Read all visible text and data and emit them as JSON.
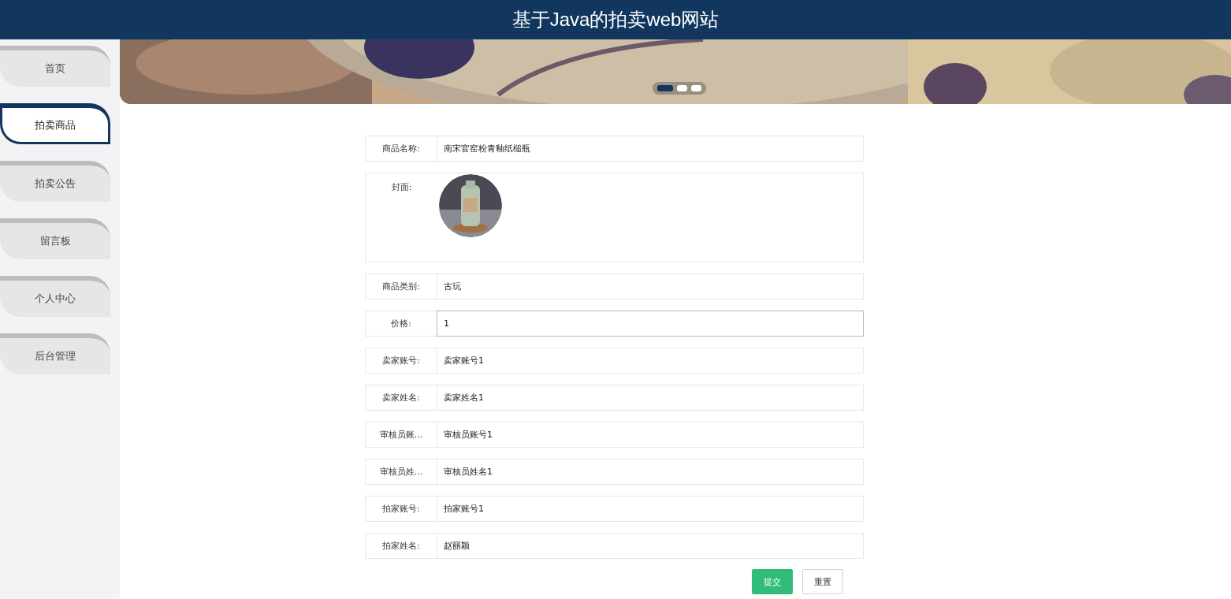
{
  "header": {
    "title": "基于Java的拍卖web网站"
  },
  "nav": [
    {
      "label": "首页",
      "selected": false
    },
    {
      "label": "拍卖商品",
      "selected": true
    },
    {
      "label": "拍卖公告",
      "selected": false
    },
    {
      "label": "留言板",
      "selected": false
    },
    {
      "label": "个人中心",
      "selected": false
    },
    {
      "label": "后台管理",
      "selected": false
    }
  ],
  "banner": {
    "kind": "picture",
    "dots": [
      {
        "selected": true
      },
      {
        "selected": false
      },
      {
        "selected": false
      }
    ]
  },
  "form": {
    "fields": [
      {
        "kind": "text",
        "label": "商品名称:",
        "value": "南宋官窑粉青釉纸槌瓶",
        "focused": false
      },
      {
        "label": "封面:"
      },
      {
        "kind": "text",
        "label": "商品类别:",
        "value": "古玩",
        "focused": false
      },
      {
        "kind": "text",
        "label": "价格:",
        "value": "1",
        "focused": true
      },
      {
        "kind": "text",
        "label": "卖家账号:",
        "value": "卖家账号1",
        "focused": false
      },
      {
        "kind": "text",
        "label": "卖家姓名:",
        "value": "卖家姓名1",
        "focused": false
      },
      {
        "kind": "text",
        "label": "审核员账...",
        "value": "审核员账号1",
        "focused": false
      },
      {
        "kind": "text",
        "label": "审核员姓...",
        "value": "审核员姓名1",
        "focused": false
      },
      {
        "kind": "text",
        "label": "拍家账号:",
        "value": "拍家账号1",
        "focused": false
      },
      {
        "kind": "text",
        "label": "拍家姓名:",
        "value": "赵丽颖",
        "focused": false
      }
    ],
    "buttons": [
      {
        "kind": "primary",
        "label": "提交"
      },
      {
        "kind": "default",
        "label": "重置"
      }
    ]
  }
}
